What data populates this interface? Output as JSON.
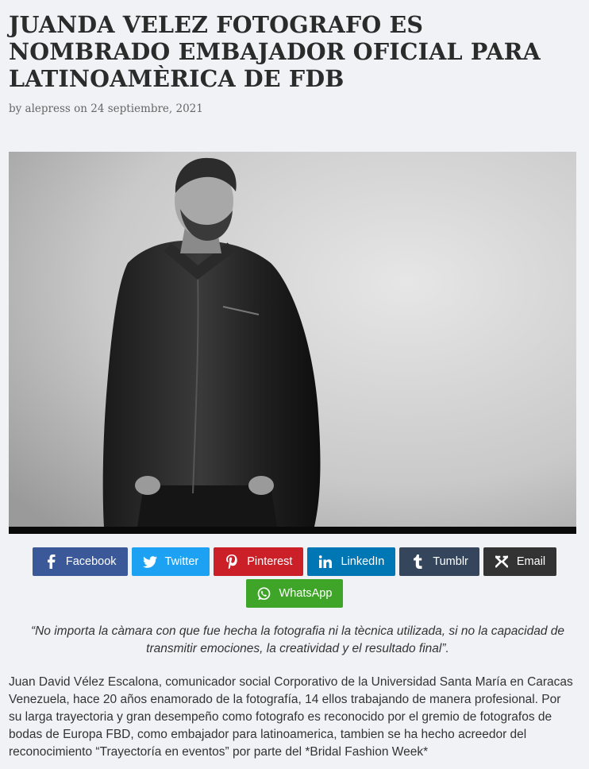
{
  "article": {
    "title": "JUANDA VELEZ FOTOGRAFO ES NOMBRADO EMBAJADOR OFICIAL PARA LATINOAMÈRICA DE FDB",
    "byline": "by alepress on 24 septiembre, 2021",
    "quote": "“No importa la càmara con que fue hecha la fotografia ni la tècnica utilizada, si no la capacidad de transmitir emociones, la creatividad y el resultado final”.",
    "body": "Juan David Vélez Escalona, comunicador social Corporativo de la Universidad Santa María en Caracas Venezuela, hace 20 años enamorado de la fotografía, 14 ellos trabajando de manera profesional. Por su larga trayectoria y gran desempeño como fotografo es reconocido por el gremio de fotografos de bodas de Europa FBD, como embajador para latinoamerica, tambien se ha hecho acreedor del reconocimiento “Trayectoría en eventos” por parte del *Bridal Fashion Week*"
  },
  "share": [
    {
      "label": "Facebook",
      "icon": "facebook-icon",
      "color": "#3b5998"
    },
    {
      "label": "Twitter",
      "icon": "twitter-icon",
      "color": "#1da1f2"
    },
    {
      "label": "Pinterest",
      "icon": "pinterest-icon",
      "color": "#cb2027"
    },
    {
      "label": "LinkedIn",
      "icon": "linkedin-icon",
      "color": "#0077b5"
    },
    {
      "label": "Tumblr",
      "icon": "tumblr-icon",
      "color": "#35465c"
    },
    {
      "label": "Email",
      "icon": "email-icon",
      "color": "#333333"
    },
    {
      "label": "WhatsApp",
      "icon": "whatsapp-icon",
      "color": "#3fa528"
    }
  ]
}
